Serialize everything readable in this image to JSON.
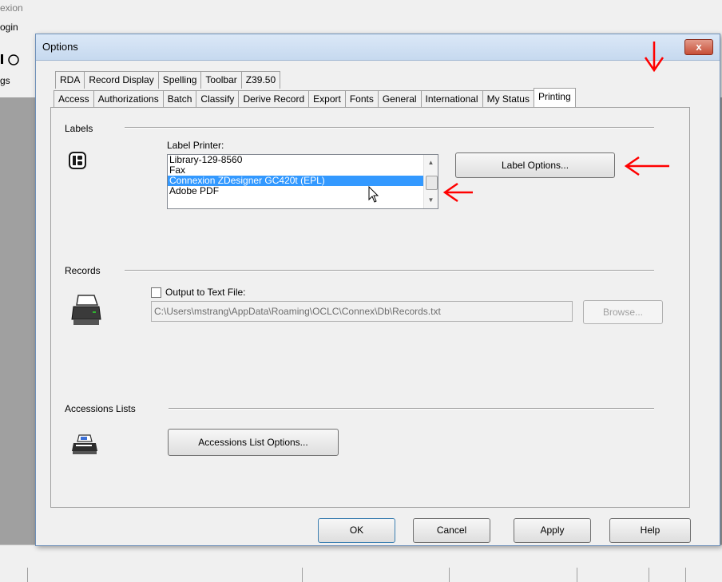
{
  "app": {
    "title_fragment": "exion",
    "menu_fragment": "ogin",
    "toolbar_fragment": "gs"
  },
  "dialog": {
    "title": "Options",
    "close_label": "x",
    "tabs_row1": [
      "RDA",
      "Record Display",
      "Spelling",
      "Toolbar",
      "Z39.50"
    ],
    "tabs_row2": [
      "Access",
      "Authorizations",
      "Batch",
      "Classify",
      "Derive Record",
      "Export",
      "Fonts",
      "General",
      "International",
      "My Status",
      "Printing"
    ],
    "active_tab": "Printing"
  },
  "labels_group": {
    "title": "Labels",
    "printer_label": "Label Printer:",
    "printers": [
      "Library-129-8560",
      "Fax",
      "Connexion ZDesigner GC420t (EPL)",
      "Adobe PDF"
    ],
    "selected_index": 2,
    "options_button": "Label Options..."
  },
  "records_group": {
    "title": "Records",
    "output_checkbox_label": "Output to Text File:",
    "output_checked": false,
    "path": "C:\\Users\\mstrang\\AppData\\Roaming\\OCLC\\Connex\\Db\\Records.txt",
    "browse_button": "Browse..."
  },
  "accessions_group": {
    "title": "Accessions Lists",
    "options_button": "Accessions List Options..."
  },
  "footer": {
    "ok": "OK",
    "cancel": "Cancel",
    "apply": "Apply",
    "help": "Help"
  },
  "annotation_color": "#ff0000",
  "icons": [
    "label-printer-icon",
    "printer-icon",
    "fax-printer-icon",
    "scroll-up-icon",
    "scroll-down-icon",
    "mouse-cursor-icon",
    "annotation-arrow-icon"
  ]
}
